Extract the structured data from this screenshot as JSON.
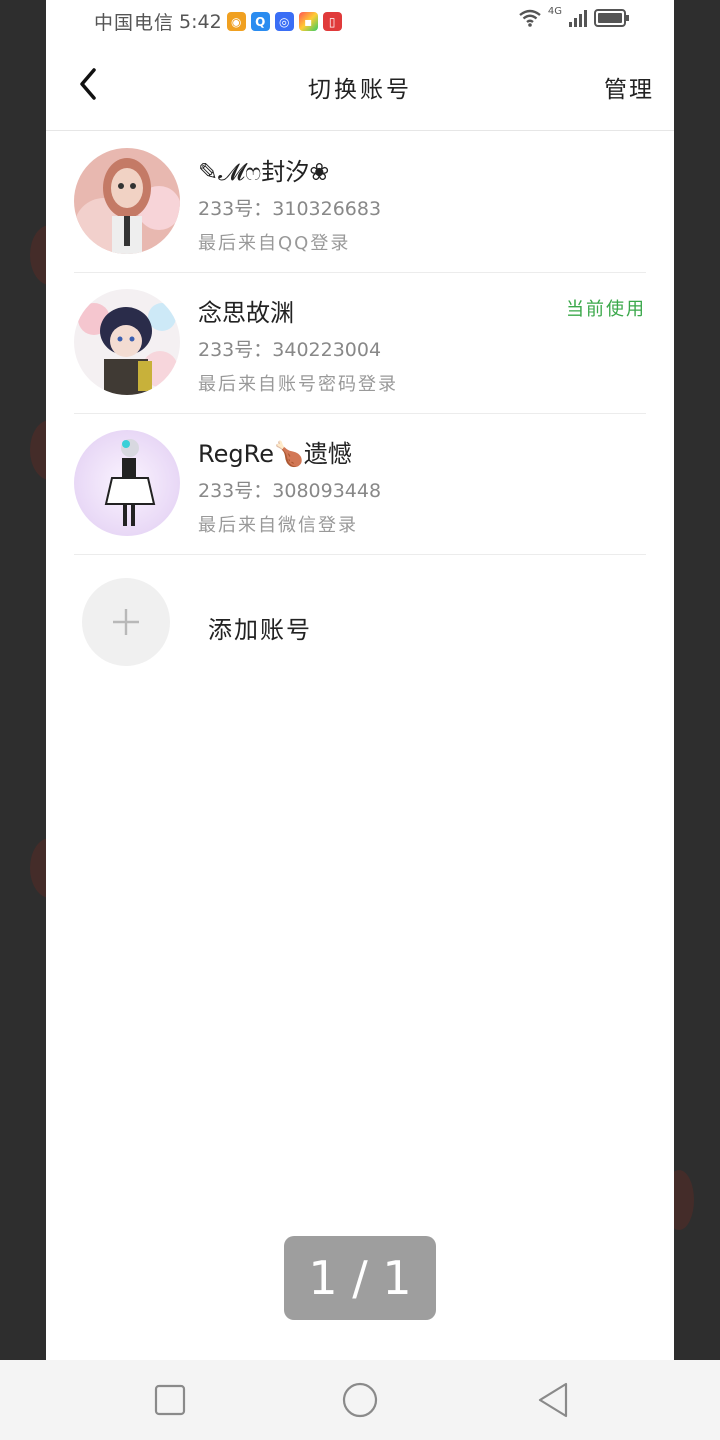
{
  "status_bar": {
    "carrier": "中国电信",
    "time": "5:42",
    "network": "4G",
    "app_icons": [
      "weibo-icon",
      "browser-icon",
      "qq-browser-icon",
      "store-icon",
      "reader-icon"
    ]
  },
  "header": {
    "title": "切换账号",
    "manage_label": "管理"
  },
  "accounts": [
    {
      "name": "✎𝓜ෆ封汐❀",
      "id": "233号：310326683",
      "login": "最后来自QQ登录",
      "current": ""
    },
    {
      "name": "念思故渊",
      "id": "233号：340223004",
      "login": "最后来自账号密码登录",
      "current": "当前使用"
    },
    {
      "name": "RegRe🍗遗憾",
      "id": "233号：308093448",
      "login": "最后来自微信登录",
      "current": ""
    }
  ],
  "add_account": {
    "label": "添加账号"
  },
  "page_indicator": "1 / 1",
  "colors": {
    "accent_current": "#3aa84a",
    "panel_bg": "#ffffff",
    "overlay_bg": "#4a4a4a"
  }
}
